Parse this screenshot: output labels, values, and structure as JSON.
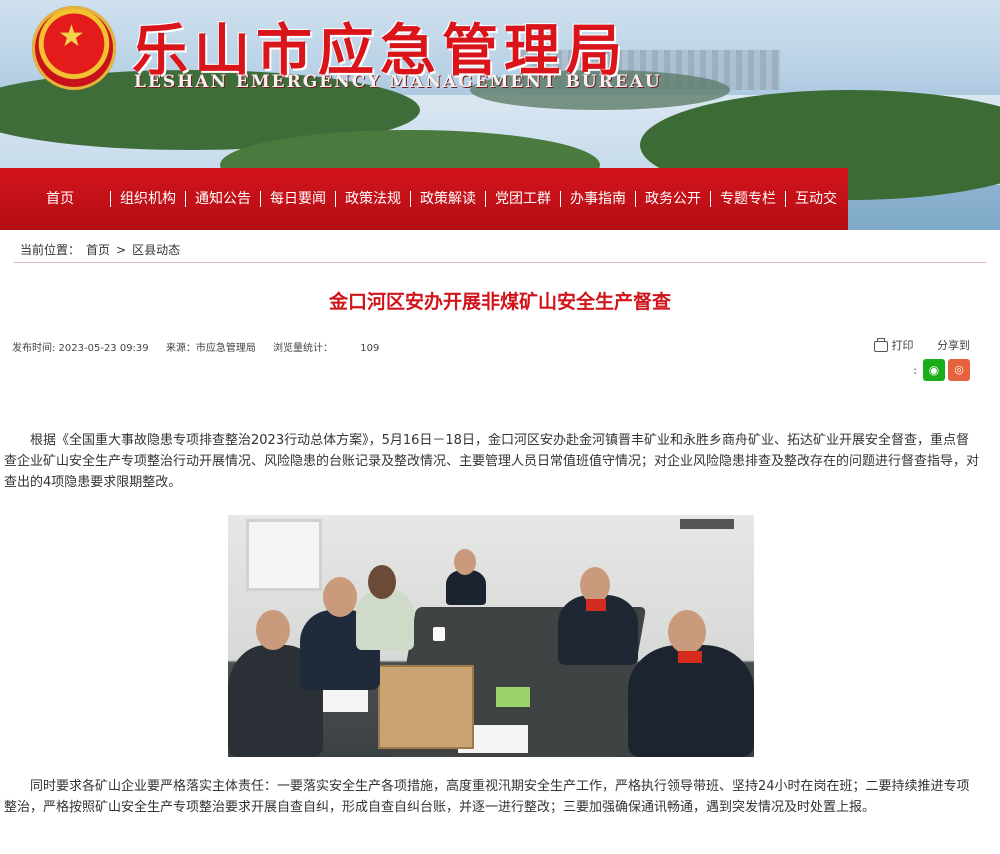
{
  "header": {
    "site_title": "乐山市应急管理局",
    "site_subtitle": "LESHAN EMERGENCY MANAGEMENT BUREAU"
  },
  "nav": {
    "items": [
      {
        "label": "首页"
      },
      {
        "label": "组织机构"
      },
      {
        "label": "通知公告"
      },
      {
        "label": "每日要闻"
      },
      {
        "label": "政策法规"
      },
      {
        "label": "政策解读"
      },
      {
        "label": "党团工群"
      },
      {
        "label": "办事指南"
      },
      {
        "label": "政务公开"
      },
      {
        "label": "专题专栏"
      },
      {
        "label": "互动交"
      }
    ]
  },
  "breadcrumb": {
    "prefix": "当前位置：",
    "home": "首页",
    "separator": ">",
    "current": "区县动态"
  },
  "article": {
    "title": "金口河区安办开展非煤矿山安全生产督查",
    "publish_time": "发布时间: 2023-05-23 09:39",
    "source": "来源：市应急管理局",
    "views_label": "浏览量统计：",
    "views_value": "109",
    "print_label": "打印",
    "share_label": "分享到",
    "share_colon": ":",
    "paragraph1": "根据《全国重大事故隐患专项排查整治2023行动总体方案》，5月16日－18日，金口河区安办赴金河镇晋丰矿业和永胜乡商舟矿业、拓达矿业开展安全督查，重点督查企业矿山安全生产专项整治行动开展情况、风险隐患的台账记录及整改情况、主要管理人员日常值班值守情况；对企业风险隐患排查及整改存在的问题进行督查指导，对查出的4项隐患要求限期整改。",
    "paragraph2": "同时要求各矿山企业要严格落实主体责任：一要落实安全生产各项措施，高度重视汛期安全生产工作，严格执行领导带班、坚持24小时在岗在班；二要持续推进专项整治，严格按照矿山安全生产专项整治要求开展自查自纠，形成自查自纠台账，并逐一进行整改；三要加强确保通讯畅通，遇到突发情况及时处置上报。"
  },
  "icons": {
    "wechat": "wechat-icon",
    "weibo": "weibo-icon",
    "print": "printer-icon"
  },
  "colors": {
    "brand_red": "#d0141b",
    "nav_red": "#c5111a"
  }
}
